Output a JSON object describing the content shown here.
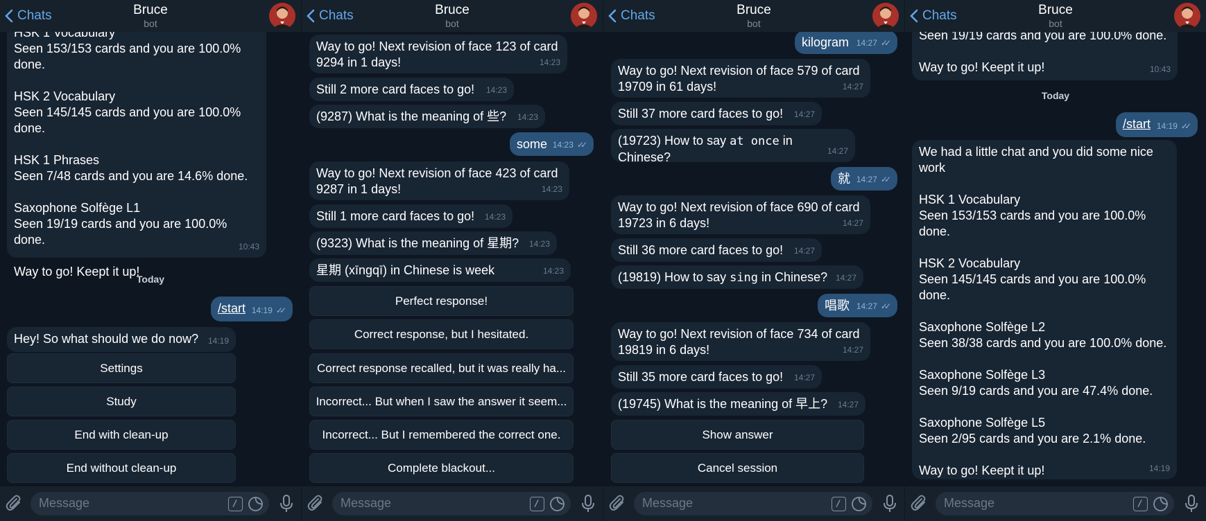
{
  "header": {
    "back_label": "Chats",
    "title": "Bruce",
    "subtitle": "bot"
  },
  "input": {
    "placeholder": "Message"
  },
  "colors": {
    "bg": "#0e1621",
    "header": "#17212b",
    "bubble_in": "#182533",
    "bubble_out": "#2b5278",
    "accent": "#62a8ea"
  },
  "screen1": {
    "m1": {
      "text": "HSK 1 Vocabulary\nSeen 153/153 cards and you are 100.0%\ndone.\n\nHSK 2 Vocabulary\nSeen 145/145 cards and you are 100.0%\ndone.\n\nHSK 1 Phrases\nSeen 7/48 cards and you are 14.6% done.\n\nSaxophone Solfège L1\nSeen 19/19 cards and you are 100.0% done.\n\nWay to go! Keept it up!",
      "time": "10:43"
    },
    "date": "Today",
    "m2": {
      "text": "/start",
      "time": "14:19"
    },
    "m3": {
      "text": "Hey! So what should we do now?",
      "time": "14:19"
    },
    "buttons": [
      "Settings",
      "Study",
      "End with clean-up",
      "End without clean-up"
    ]
  },
  "screen2": {
    "m1": {
      "text": "Way to go! Next revision of face 123 of card\n9294 in 1 days!",
      "time": "14:23"
    },
    "m2": {
      "text": "Still 2 more card faces to go!",
      "time": "14:23"
    },
    "m3": {
      "text": "(9287) What is the meaning of 些?",
      "time": "14:23"
    },
    "m4": {
      "text": "some",
      "time": "14:23"
    },
    "m5": {
      "text": "Way to go! Next revision of face 423 of card\n9287 in 1 days!",
      "time": "14:23"
    },
    "m6": {
      "text": "Still 1 more card faces to go!",
      "time": "14:23"
    },
    "m7": {
      "text": "(9323) What is the meaning of 星期?",
      "time": "14:23"
    },
    "m8": {
      "text": "星期 (xīngqī) in Chinese is week",
      "time": "14:23"
    },
    "buttons": [
      "Perfect response!",
      "Correct response, but I hesitated.",
      "Correct response recalled, but it was really ha...",
      "Incorrect... But when I saw the answer it seem...",
      "Incorrect... But I remembered the correct one.",
      "Complete blackout..."
    ]
  },
  "screen3": {
    "m1": {
      "text": "kilogram",
      "time": "14:27"
    },
    "m2": {
      "text": "Way to go! Next revision of face 579 of card\n19709 in 61 days!",
      "time": "14:27"
    },
    "m3": {
      "text": "Still 37 more card faces to go!",
      "time": "14:27"
    },
    "m4": {
      "pre": "(19723) How to say ",
      "code": "at once",
      "post": " in Chinese?",
      "time": "14:27"
    },
    "m5": {
      "text": "就",
      "time": "14:27"
    },
    "m6": {
      "text": "Way to go! Next revision of face 690 of card\n19723 in 6 days!",
      "time": "14:27"
    },
    "m7": {
      "text": "Still 36 more card faces to go!",
      "time": "14:27"
    },
    "m8": {
      "pre": "(19819) How to say ",
      "code": "sing",
      "post": " in Chinese?",
      "time": "14:27"
    },
    "m9": {
      "text": "唱歌",
      "time": "14:27"
    },
    "m10": {
      "text": "Way to go! Next revision of face 734 of card\n19819 in 6 days!",
      "time": "14:27"
    },
    "m11": {
      "text": "Still 35 more card faces to go!",
      "time": "14:27"
    },
    "m12": {
      "text": "(19745) What is the meaning of 早上?",
      "time": "14:27"
    },
    "buttons": [
      "Show answer",
      "Cancel session"
    ]
  },
  "screen4": {
    "m1": {
      "text": "Seen 19/19 cards and you are 100.0% done.\n\nWay to go! Keept it up!",
      "time": "10:43"
    },
    "date": "Today",
    "m2": {
      "text": "/start",
      "time": "14:19"
    },
    "m3": {
      "text": "We had a little chat and you did some nice\nwork\n\nHSK 1 Vocabulary\nSeen 153/153 cards and you are 100.0%\ndone.\n\nHSK 2 Vocabulary\nSeen 145/145 cards and you are 100.0%\ndone.\n\nSaxophone Solfège L2\nSeen 38/38 cards and you are 100.0% done.\n\nSaxophone Solfège L3\nSeen 9/19 cards and you are 47.4% done.\n\nSaxophone Solfège L5\nSeen 2/95 cards and you are 2.1% done.\n\nWay to go! Keept it up!",
      "time": "14:19"
    }
  }
}
